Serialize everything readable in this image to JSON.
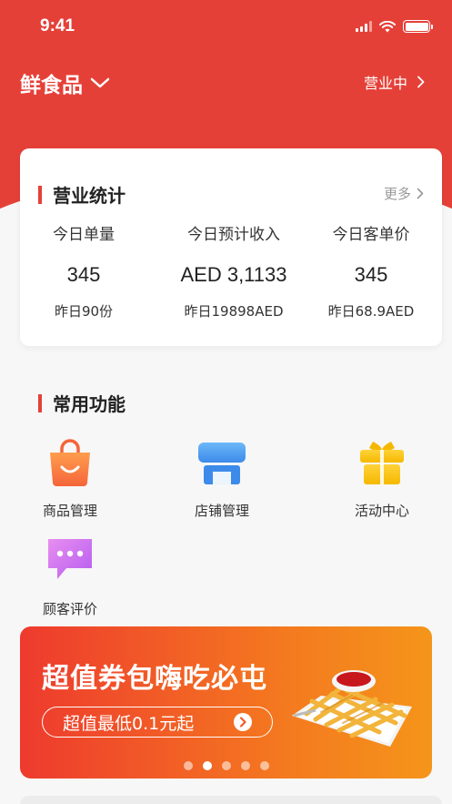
{
  "status_bar": {
    "time": "9:41"
  },
  "header": {
    "store_name": "鲜食品",
    "business_status": "营业中"
  },
  "stats": {
    "title": "营业统计",
    "more_label": "更多",
    "columns": [
      {
        "label": "今日单量",
        "value": "345",
        "yesterday": "昨日90份"
      },
      {
        "label": "今日预计收入",
        "value": "AED 3,1133",
        "yesterday": "昨日19898AED"
      },
      {
        "label": "今日客单价",
        "value": "345",
        "yesterday": "昨日68.9AED"
      }
    ]
  },
  "functions": {
    "title": "常用功能",
    "items": [
      {
        "label": "商品管理",
        "icon": "shopping-bag-icon"
      },
      {
        "label": "店铺管理",
        "icon": "storefront-icon"
      },
      {
        "label": "活动中心",
        "icon": "gift-icon"
      },
      {
        "label": "顾客评价",
        "icon": "chat-bubble-icon"
      }
    ]
  },
  "banner": {
    "headline": "超值券包嗨吃必屯",
    "cta": "超值最低0.1元起",
    "slide_count": 5,
    "active_slide": 2
  },
  "colors": {
    "brand_red": "#e54038",
    "banner_start": "#ee3a2e",
    "banner_end": "#f5951a"
  }
}
